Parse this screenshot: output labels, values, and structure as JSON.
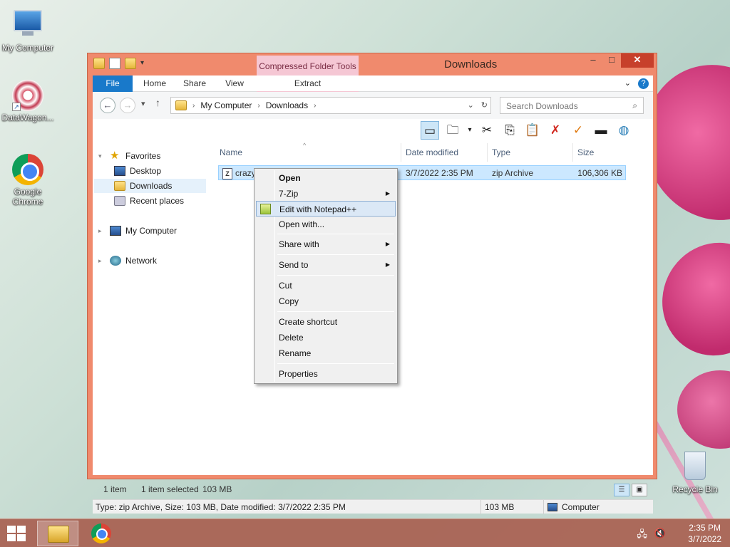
{
  "desktop": {
    "icons": [
      {
        "label": "My Computer"
      },
      {
        "label": "DataWagon..."
      },
      {
        "label": "Google Chrome"
      },
      {
        "label": "Recycle Bin"
      }
    ]
  },
  "window": {
    "title": "Downloads",
    "context_tab_group": "Compressed Folder Tools",
    "ribbon_tabs": [
      "File",
      "Home",
      "Share",
      "View",
      "Extract"
    ],
    "controls": {
      "minimize": "–",
      "maximize": "□",
      "close": "✕"
    }
  },
  "navigation": {
    "breadcrumb": [
      "My Computer",
      "Downloads"
    ],
    "search_placeholder": "Search Downloads"
  },
  "sidebar": {
    "favorites_label": "Favorites",
    "favorites": [
      "Desktop",
      "Downloads",
      "Recent places"
    ],
    "computer_label": "My Computer",
    "network_label": "Network"
  },
  "filelist": {
    "columns": [
      "Name",
      "Date modified",
      "Type",
      "Size"
    ],
    "rows": [
      {
        "name": "crazy",
        "date": "3/7/2022 2:35 PM",
        "type": "zip Archive",
        "size": "106,306 KB"
      }
    ]
  },
  "status": {
    "item_count": "1 item",
    "selected": "1 item selected",
    "selected_size": "103 MB",
    "details": "Type: zip Archive, Size: 103 MB, Date modified: 3/7/2022 2:35 PM",
    "details_size": "103 MB",
    "details_location": "Computer"
  },
  "context_menu": {
    "items": [
      "Open",
      "7-Zip",
      "Edit with Notepad++",
      "Open with...",
      "Share with",
      "Send to",
      "Cut",
      "Copy",
      "Create shortcut",
      "Delete",
      "Rename",
      "Properties"
    ]
  },
  "taskbar": {
    "time": "2:35 PM",
    "date": "3/7/2022"
  },
  "colors": {
    "window_frame": "#f08a6d",
    "file_tab": "#1979ca",
    "context_tab": "#f5c7d4",
    "selection": "#cce8ff"
  }
}
